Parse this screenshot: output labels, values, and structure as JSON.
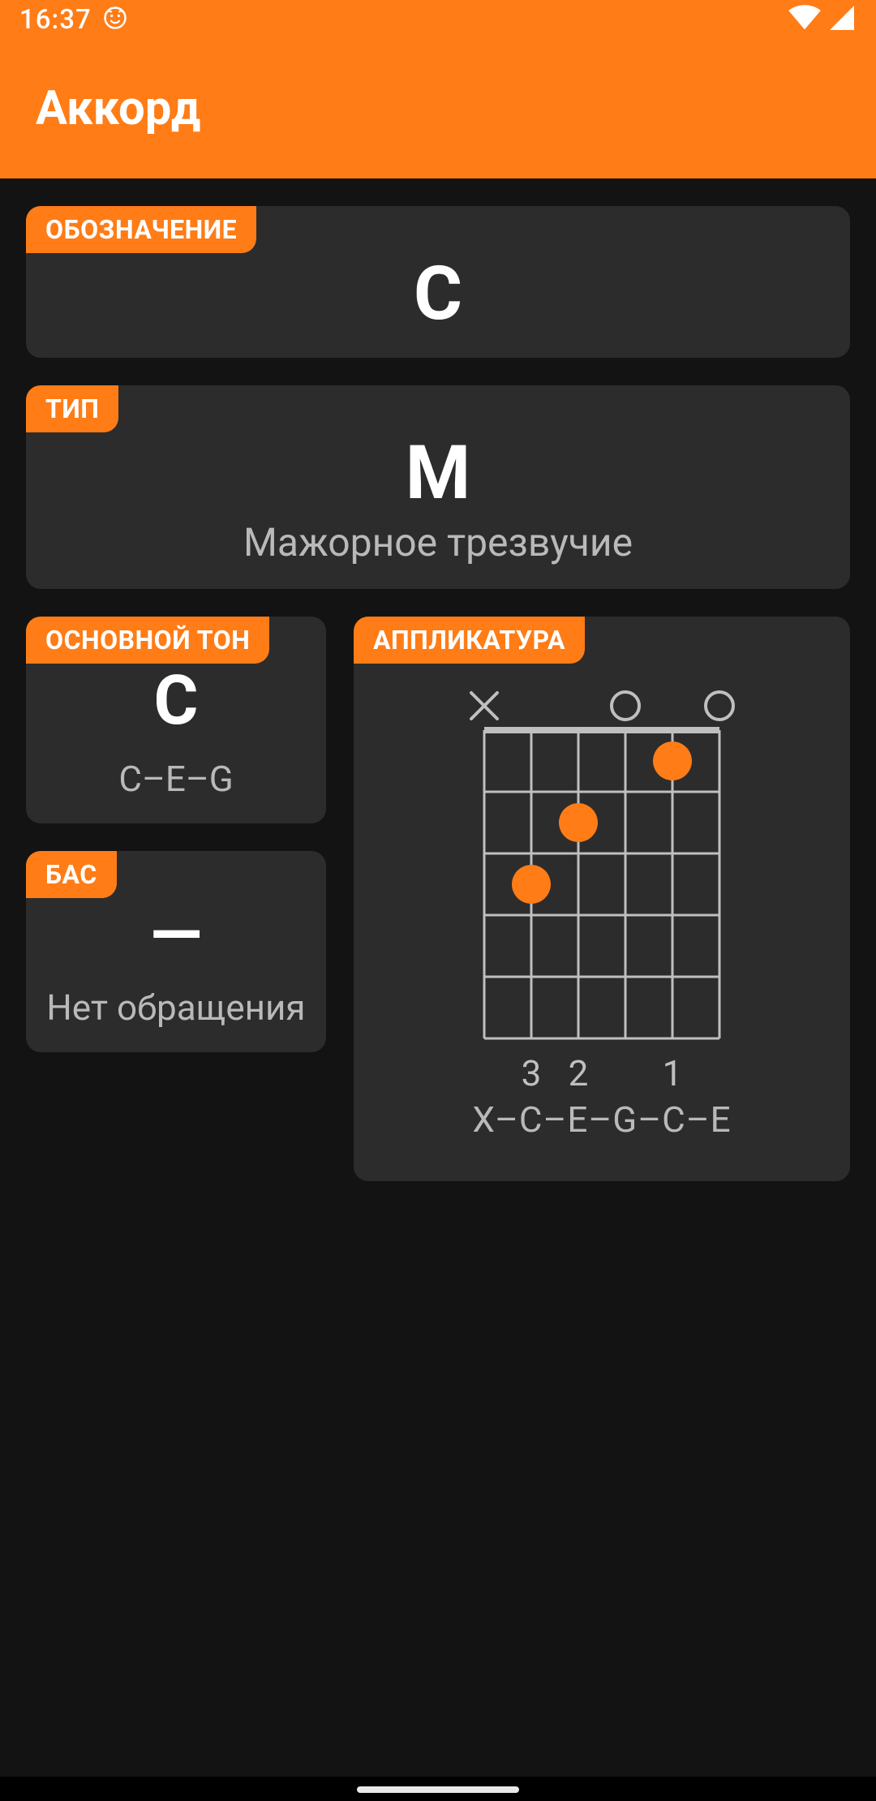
{
  "status": {
    "time": "16:37"
  },
  "app": {
    "title": "Аккорд"
  },
  "cards": {
    "designation": {
      "tag": "ОБОЗНАЧЕНИЕ",
      "value": "C"
    },
    "type": {
      "tag": "ТИП",
      "value": "M",
      "sub": "Мажорное трезвучие"
    },
    "root": {
      "tag": "ОСНОВНОЙ ТОН",
      "value": "C",
      "sub": "C–E–G"
    },
    "bass": {
      "tag": "БАС",
      "value": "—",
      "sub": "Нет обращения"
    },
    "applic": {
      "tag": "АППЛИКАТУРА",
      "fingers": [
        "",
        "3",
        "2",
        "",
        "1",
        ""
      ],
      "notes": "X–C–E–G–C–E"
    }
  },
  "chart_data": {
    "type": "table",
    "strings": 6,
    "frets_shown": 5,
    "top_markers": [
      "x",
      null,
      null,
      "o",
      null,
      "o"
    ],
    "dots": [
      {
        "string": 2,
        "fret": 3
      },
      {
        "string": 3,
        "fret": 2
      },
      {
        "string": 5,
        "fret": 1
      }
    ],
    "finger_labels": [
      "",
      "3",
      "2",
      "",
      "1",
      ""
    ],
    "string_notes": [
      "X",
      "C",
      "E",
      "G",
      "C",
      "E"
    ]
  }
}
